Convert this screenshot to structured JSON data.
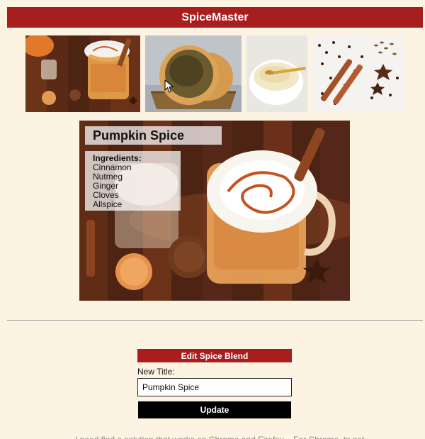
{
  "header": {
    "title": "SpiceMaster"
  },
  "gallery": [
    {
      "name": "pumpkin-spice-latte",
      "alt": ""
    },
    {
      "name": "zaatar-flatbread",
      "alt": ""
    },
    {
      "name": "ground-spice-bowl",
      "alt": ""
    },
    {
      "name": "whole-spices",
      "alt": ""
    }
  ],
  "hero": {
    "title": "Pumpkin Spice",
    "ingredients_label": "Ingredients:",
    "ingredients": [
      "Cinnamon",
      "Nutmeg",
      "Ginger",
      "Cloves",
      "Allspice"
    ]
  },
  "edit": {
    "header": "Edit Spice Blend",
    "field_label": "New Title:",
    "field_value": "Pumpkin Spice",
    "button_label": "Update"
  },
  "footer": {
    "snippet": "I need find a solution that works on Chrome and Firefox... For Chrome, to set"
  },
  "colors": {
    "accent": "#a81d1e",
    "background": "#fdf3e2",
    "button": "#000000"
  }
}
